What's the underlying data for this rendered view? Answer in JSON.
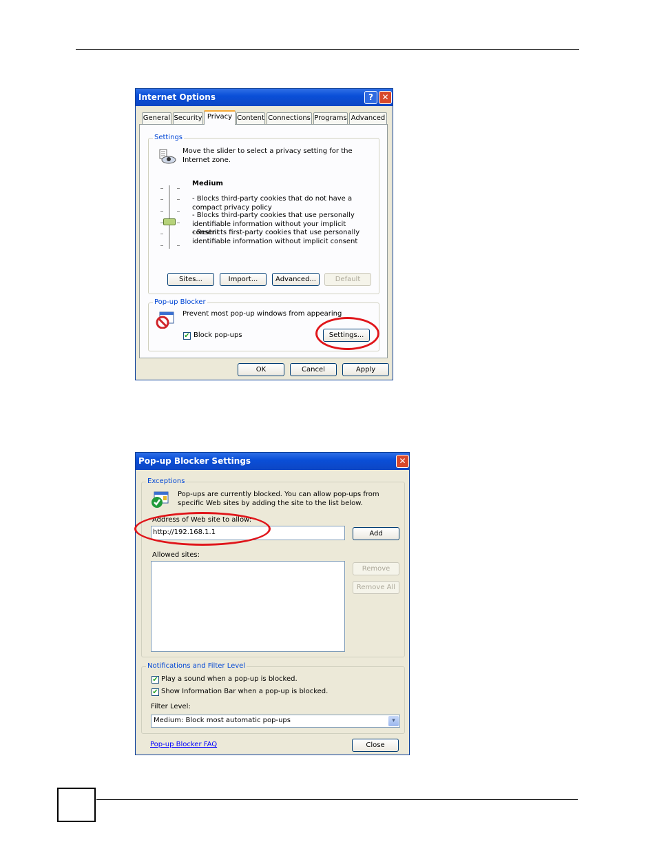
{
  "internet_options": {
    "title": "Internet Options",
    "help_glyph": "?",
    "close_glyph": "✕",
    "tabs": [
      "General",
      "Security",
      "Privacy",
      "Content",
      "Connections",
      "Programs",
      "Advanced"
    ],
    "active_tab": "Privacy",
    "settings": {
      "group_label": "Settings",
      "intro": "Move the slider to select a privacy setting for the Internet zone.",
      "level_title": "Medium",
      "bullets": [
        "- Blocks third-party cookies that do not have a compact privacy policy",
        "- Blocks third-party cookies that use personally identifiable information without your implicit consent",
        "- Restricts first-party cookies that use personally identifiable information without implicit consent"
      ],
      "slider_level": "Medium",
      "buttons": {
        "sites": "Sites...",
        "import": "Import...",
        "advanced": "Advanced...",
        "default": "Default"
      }
    },
    "popup_blocker": {
      "group_label": "Pop-up Blocker",
      "description": "Prevent most pop-up windows from appearing",
      "checkbox_label": "Block pop-ups",
      "checkbox_checked": true,
      "settings_button": "Settings..."
    },
    "footer_buttons": {
      "ok": "OK",
      "cancel": "Cancel",
      "apply": "Apply"
    }
  },
  "popup_settings": {
    "title": "Pop-up Blocker Settings",
    "close_glyph": "✕",
    "exceptions": {
      "group_label": "Exceptions",
      "description": "Pop-ups are currently blocked. You can allow pop-ups from specific Web sites by adding the site to the list below.",
      "address_label": "Address of Web site to allow:",
      "address_value": "http://192.168.1.1",
      "add_button": "Add",
      "allowed_label": "Allowed sites:",
      "allowed_sites": [],
      "remove_button": "Remove",
      "remove_all_button": "Remove All"
    },
    "notifications": {
      "group_label": "Notifications and Filter Level",
      "play_sound_label": "Play a sound when a pop-up is blocked.",
      "play_sound_checked": true,
      "info_bar_label": "Show Information Bar when a pop-up is blocked.",
      "info_bar_checked": true,
      "filter_label": "Filter Level:",
      "filter_value": "Medium: Block most automatic pop-ups"
    },
    "faq_link": "Pop-up Blocker FAQ",
    "close_button": "Close"
  },
  "checkmark_glyph": "✔",
  "dropdown_glyph": "▾",
  "colors": {
    "title_bar": "#0a4fd8",
    "dialog_bg": "#ece9d8",
    "group_label": "#0046d5",
    "highlight_ring": "#e0161b",
    "link": "#0000ff"
  }
}
